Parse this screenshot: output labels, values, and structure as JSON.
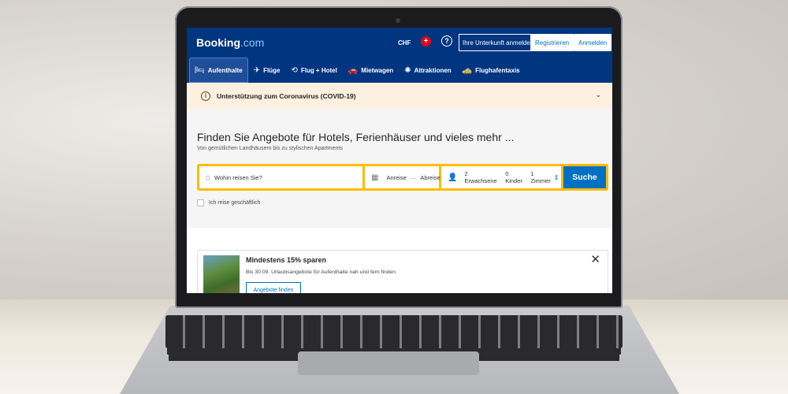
{
  "header": {
    "logo_main": "Booking",
    "logo_suffix": ".com",
    "currency": "CHF",
    "flag_symbol": "+",
    "help_symbol": "?",
    "list_property": "Ihre Unterkunft anmelden",
    "register": "Registrieren",
    "login": "Anmelden"
  },
  "nav": {
    "items": [
      {
        "label": "Aufenthalte",
        "icon": "bed-icon",
        "glyph": "🛏"
      },
      {
        "label": "Flüge",
        "icon": "plane-icon",
        "glyph": "✈"
      },
      {
        "label": "Flug + Hotel",
        "icon": "flight-hotel-icon",
        "glyph": "⟲"
      },
      {
        "label": "Mietwagen",
        "icon": "car-icon",
        "glyph": "🚗"
      },
      {
        "label": "Attraktionen",
        "icon": "attractions-icon",
        "glyph": "✺"
      },
      {
        "label": "Flughafentaxis",
        "icon": "taxi-icon",
        "glyph": "🚕"
      }
    ]
  },
  "covid": {
    "text": "Unterstützung zum Coronavirus (COVID-19)",
    "warn_symbol": "i",
    "chevron": "⌄"
  },
  "hero": {
    "title": "Finden Sie Angebote für Hotels, Ferienhäuser und vieles mehr ...",
    "subtitle": "Von gemütlichen Landhäusern bis zu stylischen Apartments"
  },
  "search": {
    "destination_placeholder": "Wohin reisen Sie?",
    "checkin": "Anreise",
    "date_separator": "—",
    "checkout": "Abreise",
    "adults": "2 Erwachsene",
    "dot": "·",
    "children": "0 Kinder",
    "rooms": "1 Zimmer",
    "button": "Suche",
    "business_label": "Ich reise geschäftlich"
  },
  "promo": {
    "title": "Mindestens 15% sparen",
    "text": "Bis 30.09. Urlaubsangebote für Aufenthalte nah und fern finden",
    "button": "Angebote finden",
    "close_symbol": "✕"
  },
  "colors": {
    "brand_blue": "#003580",
    "accent_yellow": "#febb02",
    "action_blue": "#0071c2"
  }
}
